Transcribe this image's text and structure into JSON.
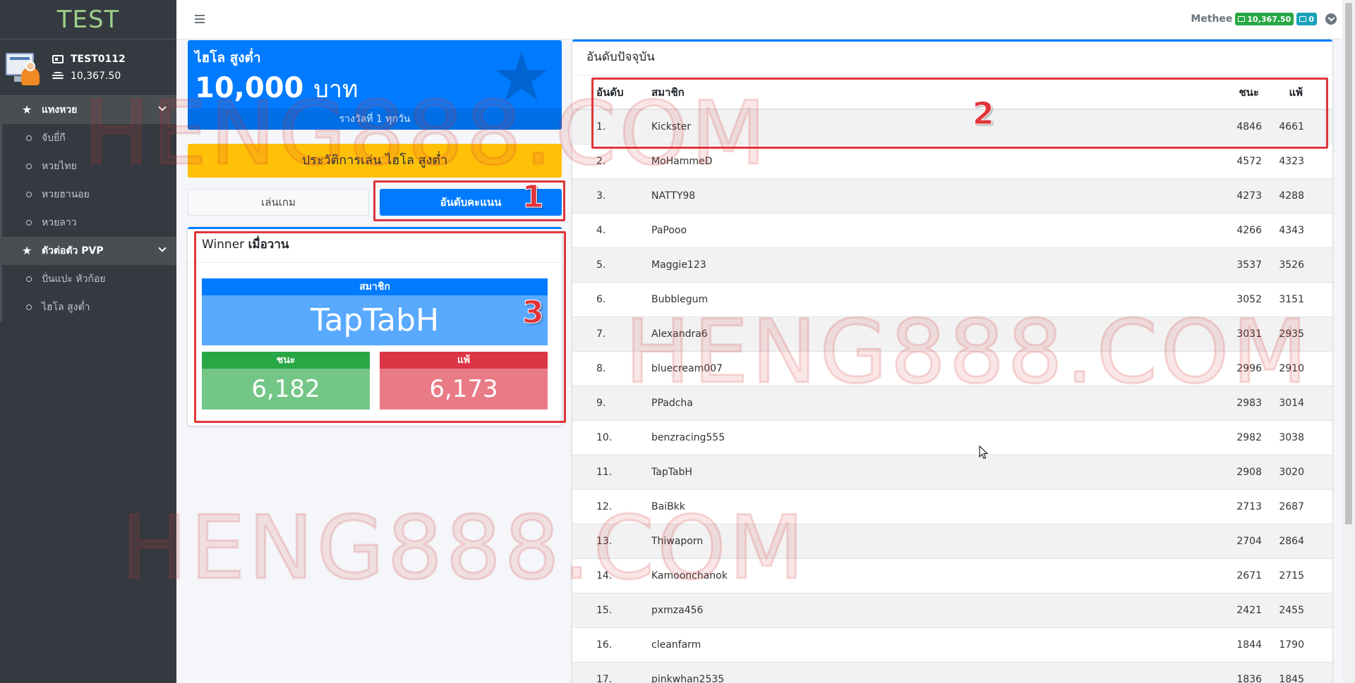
{
  "brand": "TEST",
  "user": {
    "id": "TEST0112",
    "balance": "10,367.50"
  },
  "sidebar": {
    "section1": "แทงหวย",
    "items1": [
      "จับยี่กี",
      "หวยไทย",
      "หวยฮานอย",
      "หวยลาว"
    ],
    "section2": "ตัวต่อตัว PVP",
    "items2": [
      "ปั่นแปะ หัวก้อย",
      "ไฮโล สูงต่ำ"
    ]
  },
  "topbar": {
    "username": "Methee",
    "credit_badge": "10,367.50",
    "second_badge": "0"
  },
  "hero": {
    "title": "ไฮโล สูงต่ำ",
    "amount": "10,000",
    "unit": "บาท",
    "footer": "รางวัลที่ 1 ทุกวัน"
  },
  "history_button": "ประวัติการเล่น ไฮโล สูงต่ำ",
  "tabs": {
    "play": "เล่นเกม",
    "rank": "อันดับคะแนน"
  },
  "winner": {
    "title_prefix": "Winner",
    "title_suffix": "เมื่อวาน",
    "member_label": "สมาชิก",
    "member_name": "TapTabH",
    "win_label": "ชนะ",
    "win_value": "6,182",
    "lose_label": "แพ้",
    "lose_value": "6,173"
  },
  "ranking": {
    "title": "อันดับปัจจุบัน",
    "columns": [
      "อันดับ",
      "สมาชิก",
      "ชนะ",
      "แพ้"
    ],
    "rows": [
      [
        "1.",
        "Kickster",
        "4846",
        "4661"
      ],
      [
        "2.",
        "MoHammeD",
        "4572",
        "4323"
      ],
      [
        "3.",
        "NATTY98",
        "4273",
        "4288"
      ],
      [
        "4.",
        "PaPooo",
        "4266",
        "4343"
      ],
      [
        "5.",
        "Maggie123",
        "3537",
        "3526"
      ],
      [
        "6.",
        "Bubblegum",
        "3052",
        "3151"
      ],
      [
        "7.",
        "Alexandra6",
        "3031",
        "2935"
      ],
      [
        "8.",
        "bluecream007",
        "2996",
        "2910"
      ],
      [
        "9.",
        "PPadcha",
        "2983",
        "3014"
      ],
      [
        "10.",
        "benzracing555",
        "2982",
        "3038"
      ],
      [
        "11.",
        "TapTabH",
        "2908",
        "3020"
      ],
      [
        "12.",
        "BaiBkk",
        "2713",
        "2687"
      ],
      [
        "13.",
        "Thiwaporn",
        "2704",
        "2864"
      ],
      [
        "14.",
        "Kamoonchanok",
        "2671",
        "2715"
      ],
      [
        "15.",
        "pxmza456",
        "2421",
        "2455"
      ],
      [
        "16.",
        "cleanfarm",
        "1844",
        "1790"
      ],
      [
        "17.",
        "pinkwhan2535",
        "1836",
        "1845"
      ]
    ]
  },
  "annotations": [
    "1",
    "2",
    "3"
  ],
  "watermark": "HENG888.COM",
  "colors": {
    "primary": "#007bff",
    "warning": "#ffc107",
    "success": "#28a745",
    "danger": "#dc3545",
    "sidebar": "#343a40",
    "annotation": "#e0353a"
  }
}
